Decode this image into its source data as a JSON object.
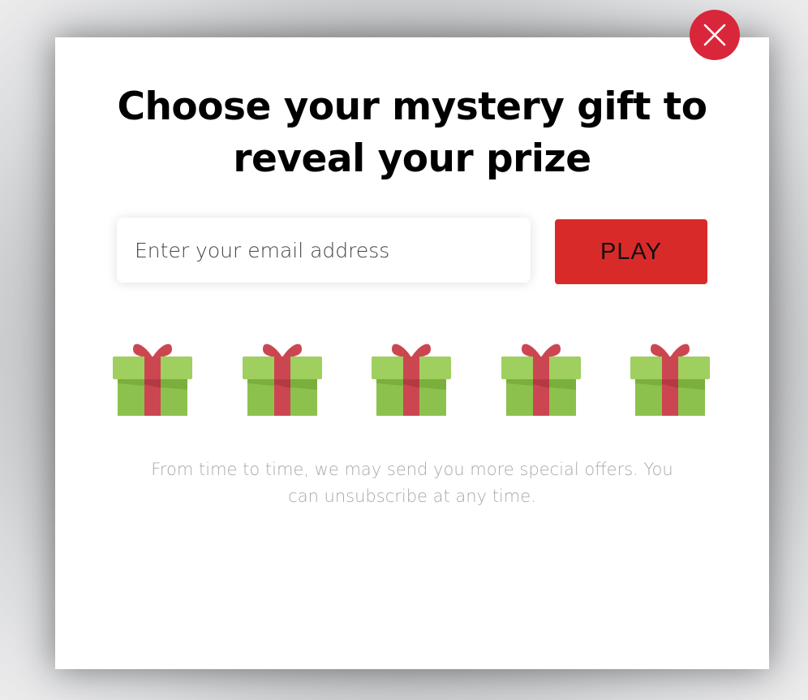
{
  "modal": {
    "title_line1": "Choose your mystery gift to",
    "title_line2": "reveal your prize",
    "email_placeholder": "Enter your email address",
    "play_label": "PLAY",
    "disclaimer": "From time to time, we may send you more special offers. You can unsubscribe at any time.",
    "close_icon": "close-icon",
    "gift_icon": "gift-box-icon",
    "gift_count": 5
  },
  "colors": {
    "accent_red": "#d9263b",
    "play_button": "#d92a2a",
    "gift_green": "#8dc14d",
    "gift_ribbon": "#cc4652"
  }
}
